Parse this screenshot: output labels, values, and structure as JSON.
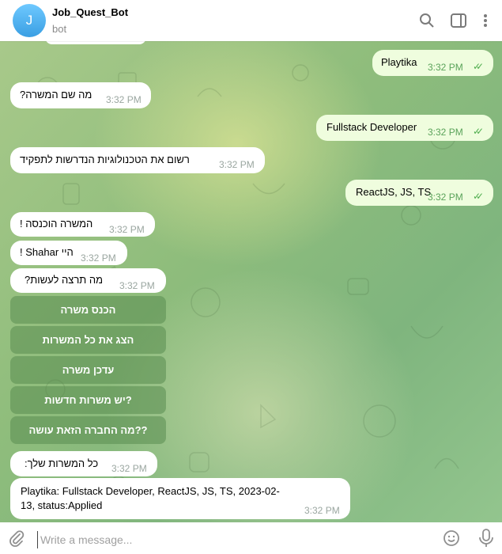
{
  "header": {
    "avatar_letter": "J",
    "title": "Job_Quest_Bot",
    "subtitle": "bot",
    "icons": [
      "search-icon",
      "sidebar-toggle-icon",
      "more-vertical-icon"
    ]
  },
  "messages": [
    {
      "dir": "out",
      "text": "Playtika",
      "time": "3:32 PM",
      "read": true
    },
    {
      "dir": "in",
      "text": "מה שם המשרה?",
      "time": "3:32 PM"
    },
    {
      "dir": "out",
      "text": "Fullstack Developer",
      "time": "3:32 PM",
      "read": true
    },
    {
      "dir": "in",
      "text": "רשום את הטכנולוגיות הנדרשות לתפקיד",
      "time": "3:32 PM"
    },
    {
      "dir": "out",
      "text": "ReactJS, JS, TS",
      "time": "3:32 PM",
      "read": true
    },
    {
      "dir": "in",
      "text": "המשרה הוכנסה !",
      "time": "3:32 PM"
    },
    {
      "dir": "in",
      "text": "היי Shahar !",
      "time": "3:32 PM"
    },
    {
      "dir": "in",
      "text": "מה תרצה לעשות?",
      "time": "3:32 PM"
    },
    {
      "dir": "in",
      "text": "כל המשרות שלך:",
      "time": "3:32 PM"
    },
    {
      "dir": "in",
      "text": "Playtika: Fullstack Developer, ReactJS, JS, TS, 2023-02-13, status:Applied",
      "time": "3:32 PM"
    }
  ],
  "keyboard": [
    "הכנס משרה",
    "הצג את כל המשרות",
    "עדכן משרה",
    "יש משרות חדשות?",
    "מה החברה הזאת עושה??"
  ],
  "composer": {
    "placeholder": "Write a message...",
    "icons": [
      "attach-icon",
      "emoji-icon",
      "microphone-icon"
    ]
  },
  "colors": {
    "accent": "#4fae4e",
    "out_bubble": "#effdde",
    "in_bubble": "#ffffff",
    "avatar": "#4aa8ee"
  }
}
